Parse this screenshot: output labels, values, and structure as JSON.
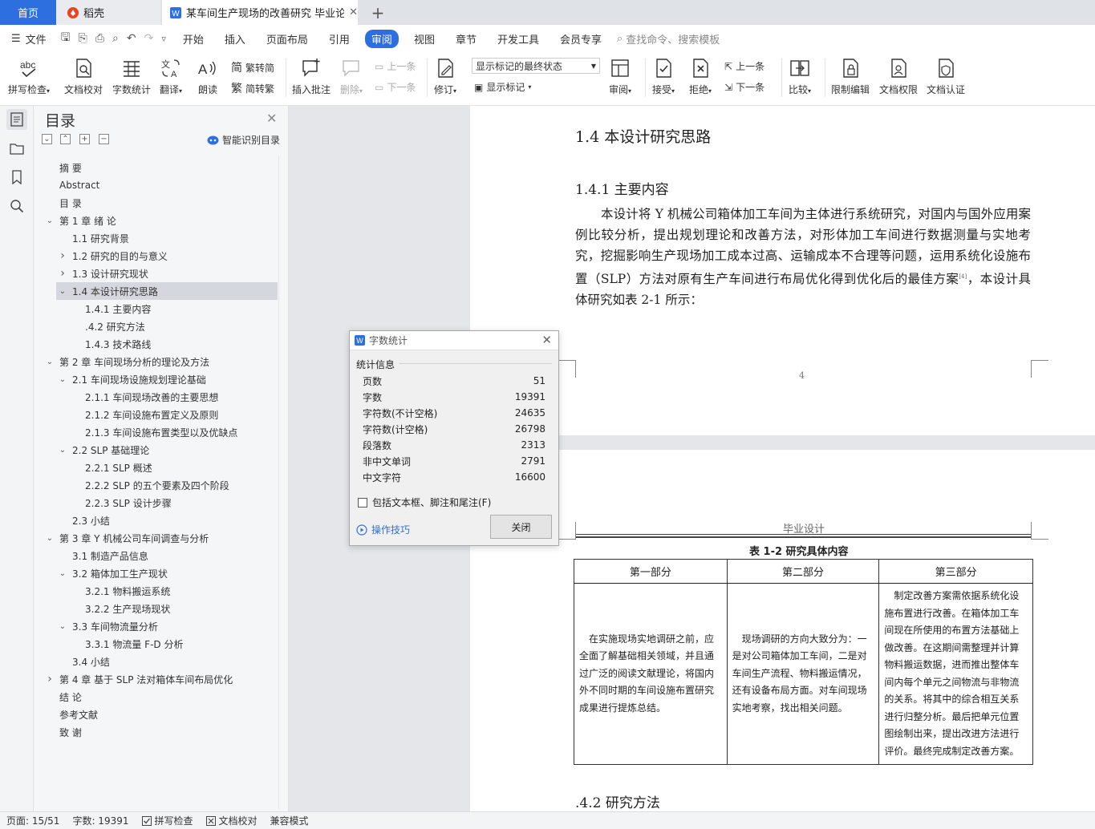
{
  "tabs": {
    "home": "首页",
    "daoke": "稻壳",
    "doc": "某车间生产现场的改善研究 毕业论文",
    "add": "+"
  },
  "menu": {
    "file": "文件",
    "items": [
      "开始",
      "插入",
      "页面布局",
      "引用",
      "审阅",
      "视图",
      "章节",
      "开发工具",
      "会员专享"
    ],
    "active": "审阅",
    "search_placeholder": "查找命令、搜索模板"
  },
  "ribbon": {
    "spell": "拼写检查",
    "proofread": "文档校对",
    "wordcount": "字数统计",
    "translate": "翻译",
    "read": "朗读",
    "trad_to_simp": "繁转简",
    "simp_to_trad": "简转繁",
    "insert_comment": "插入批注",
    "delete": "删除",
    "prev": "上一条",
    "next": "下一条",
    "track": "修订",
    "markup_select": "显示标记的最终状态",
    "show_markup": "显示标记",
    "review": "审阅",
    "accept": "接受",
    "reject": "拒绝",
    "prev2": "上一条",
    "next2": "下一条",
    "compare": "比较",
    "restrict": "限制编辑",
    "permission": "文档权限",
    "certify": "文档认证"
  },
  "toc": {
    "title": "目录",
    "smart": "智能识别目录",
    "items": [
      {
        "label": "摘  要",
        "level": 0,
        "arrow": ""
      },
      {
        "label": "Abstract",
        "level": 0,
        "arrow": ""
      },
      {
        "label": "目  录",
        "level": 0,
        "arrow": ""
      },
      {
        "label": "第 1 章  绪    论",
        "level": 0,
        "arrow": "v"
      },
      {
        "label": "1.1  研究背景",
        "level": 1,
        "arrow": ""
      },
      {
        "label": "1.2  研究的目的与意义",
        "level": 1,
        "arrow": ">"
      },
      {
        "label": "1.3  设计研究现状",
        "level": 1,
        "arrow": ">"
      },
      {
        "label": "1.4  本设计研究思路",
        "level": 1,
        "arrow": "v",
        "selected": true
      },
      {
        "label": "1.4.1  主要内容",
        "level": 2,
        "arrow": ""
      },
      {
        "label": ".4.2  研究方法",
        "level": 2,
        "arrow": ""
      },
      {
        "label": "1.4.3  技术路线",
        "level": 2,
        "arrow": ""
      },
      {
        "label": "第 2 章  车间现场分析的理论及方法",
        "level": 0,
        "arrow": "v"
      },
      {
        "label": "2.1  车间现场设施规划理论基础",
        "level": 1,
        "arrow": "v"
      },
      {
        "label": "2.1.1  车间现场改善的主要思想",
        "level": 2,
        "arrow": ""
      },
      {
        "label": "2.1.2  车间设施布置定义及原则",
        "level": 2,
        "arrow": ""
      },
      {
        "label": "2.1.3  车间设施布置类型以及优缺点",
        "level": 2,
        "arrow": ""
      },
      {
        "label": "2.2 SLP 基础理论",
        "level": 1,
        "arrow": "v"
      },
      {
        "label": "2.2.1 SLP 概述",
        "level": 2,
        "arrow": ""
      },
      {
        "label": "2.2.2 SLP 的五个要素及四个阶段",
        "level": 2,
        "arrow": ""
      },
      {
        "label": "2.2.3 SLP 设计步骤",
        "level": 2,
        "arrow": ""
      },
      {
        "label": "2.3  小结",
        "level": 1,
        "arrow": ""
      },
      {
        "label": "第 3 章  Y 机械公司车间调查与分析",
        "level": 0,
        "arrow": "v"
      },
      {
        "label": "3.1  制造产品信息",
        "level": 1,
        "arrow": ""
      },
      {
        "label": "3.2  箱体加工生产现状",
        "level": 1,
        "arrow": "v"
      },
      {
        "label": "3.2.1  物料搬运系统",
        "level": 2,
        "arrow": ""
      },
      {
        "label": "3.2.2  生产现场现状",
        "level": 2,
        "arrow": ""
      },
      {
        "label": "3.3  车间物流量分析",
        "level": 1,
        "arrow": "v"
      },
      {
        "label": "3.3.1  物流量 F-D 分析",
        "level": 2,
        "arrow": ""
      },
      {
        "label": "3.4  小结",
        "level": 1,
        "arrow": ""
      },
      {
        "label": "第 4 章  基于 SLP 法对箱体车间布局优化",
        "level": 0,
        "arrow": ">"
      },
      {
        "label": "结  论",
        "level": 0,
        "arrow": ""
      },
      {
        "label": "参考文献",
        "level": 0,
        "arrow": ""
      },
      {
        "label": "致  谢",
        "level": 0,
        "arrow": ""
      }
    ]
  },
  "page1": {
    "h2": "1.4  本设计研究思路",
    "h3": "1.4.1  主要内容",
    "para": "本设计将 Y 机械公司箱体加工车间为主体进行系统研究，对国内与国外应用案例比较分析，提出规划理论和改善方法，对形体加工车间进行数据测量与实地考究，挖掘影响生产现场加工成本过高、运输成本不合理等问题，运用系统化设施布置（SLP）方法对原有生产车间进行布局优化得到优化后的最佳方案",
    "cite": "[4]",
    "para_end": "，本设计具体研究如表 2-1 所示：",
    "page_number": "4"
  },
  "page2": {
    "header": "毕业设计",
    "caption": "表 1-2    研究具体内容",
    "cols": [
      "第一部分",
      "第二部分",
      "第三部分"
    ],
    "cells": [
      "在实施现场实地调研之前，应全面了解基础相关领域，并且通过广泛的阅读文献理论，将国内外不同时期的车间设施布置研究成果进行提炼总结。",
      "现场调研的方向大致分为：一是对公司箱体加工车间，二是对车间生产流程、物料搬运情况，还有设备布局方面。对车间现场实地考察，找出相关问题。",
      "制定改善方案需依据系统化设施布置进行改善。在箱体加工车间现在所使用的布置方法基础上做改善。在这期间需整理并计算物料搬运数据，进而推出整体车间内每个单元之间物流与非物流的关系。将其中的综合相互关系进行归整分析。最后把单元位置图绘制出来，提出改进方法进行评价。最终完成制定改善方案。"
    ],
    "h3": ".4.2  研究方法"
  },
  "dialog": {
    "title": "字数统计",
    "section": "统计信息",
    "rows": [
      {
        "label": "页数",
        "value": "51"
      },
      {
        "label": "字数",
        "value": "19391"
      },
      {
        "label": "字符数(不计空格)",
        "value": "24635"
      },
      {
        "label": "字符数(计空格)",
        "value": "26798"
      },
      {
        "label": "段落数",
        "value": "2313"
      },
      {
        "label": "非中文单词",
        "value": "2791"
      },
      {
        "label": "中文字符",
        "value": "16600"
      }
    ],
    "checkbox": "包括文本框、脚注和尾注(F)",
    "tips": "操作技巧",
    "close": "关闭"
  },
  "status": {
    "page": "页面: 15/51",
    "words": "字数: 19391",
    "spell": "拼写检查",
    "proof": "文档校对",
    "compat": "兼容模式"
  },
  "colors": {
    "accent": "#2e6fe0",
    "home_tab": "#2e6fe0",
    "selected_toc": "#d4d8de"
  }
}
